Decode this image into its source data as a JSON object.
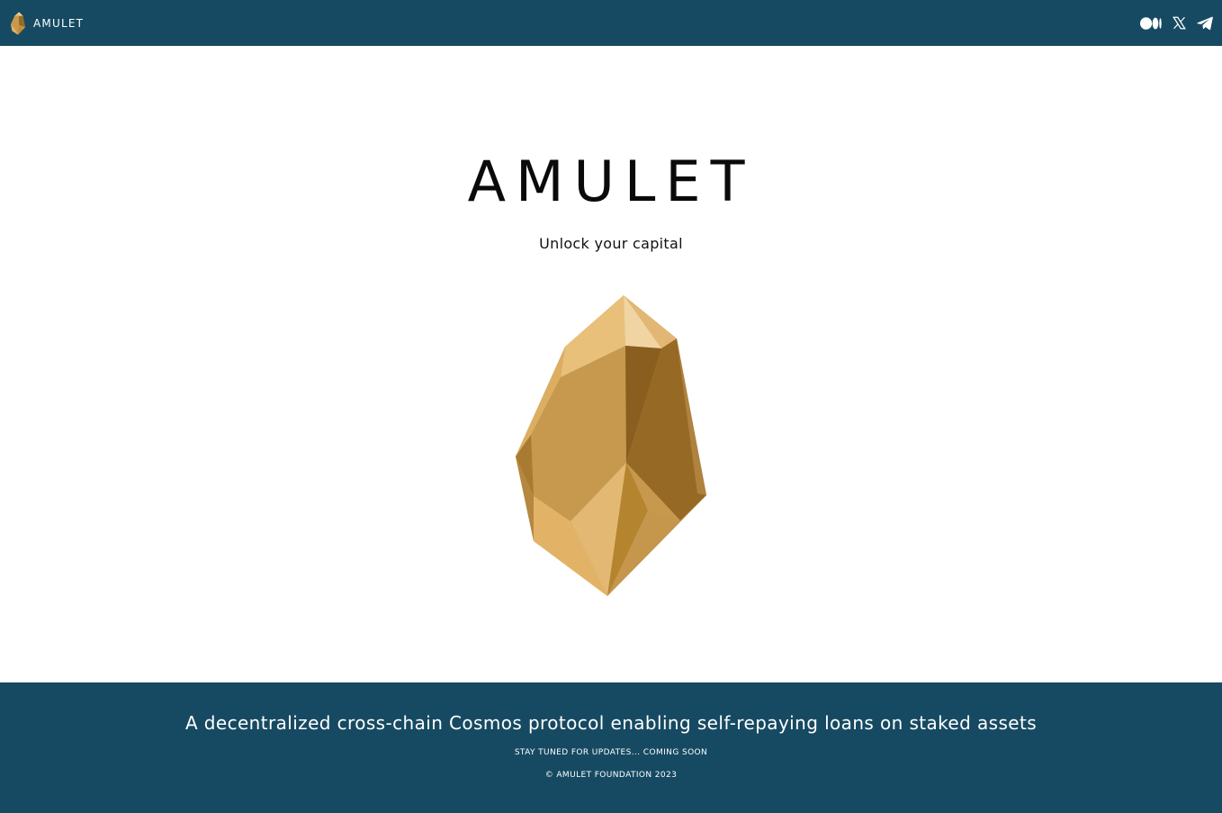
{
  "header": {
    "brand_name": "AMULET",
    "logo_icon": "amulet-gem-logo",
    "socials": [
      {
        "name": "medium",
        "icon": "medium-icon"
      },
      {
        "name": "x",
        "icon": "x-icon"
      },
      {
        "name": "telegram",
        "icon": "telegram-icon"
      }
    ]
  },
  "hero": {
    "title": "AMULET",
    "subtitle": "Unlock your capital",
    "image_icon": "amulet-gem"
  },
  "footer": {
    "tagline": "A decentralized cross-chain Cosmos protocol enabling self-repaying loans on staked assets",
    "notice": "STAY TUNED FOR UPDATES... COMING SOON",
    "copyright": "© AMULET FOUNDATION 2023"
  },
  "colors": {
    "brand_dark": "#164a62",
    "background": "#ffffff",
    "gold_light": "#e8c07a",
    "gold_mid": "#c6994e",
    "gold_dark": "#966a24"
  }
}
